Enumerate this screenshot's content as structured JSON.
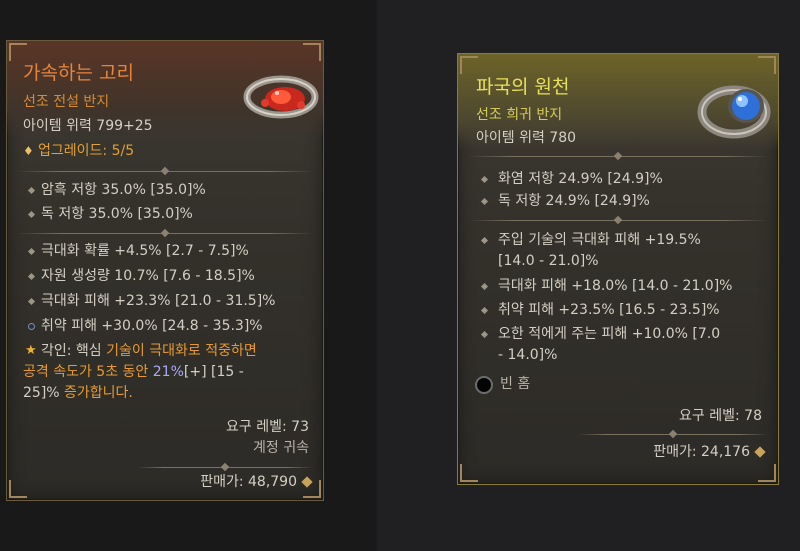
{
  "left_item": {
    "name": "가속하는 고리",
    "type": "선조 전설 반지",
    "power": "아이템 위력 799+25",
    "upgrade": "업그레이드: 5/5",
    "implicits": [
      "암흑 저항 35.0% [35.0]%",
      "독 저항 35.0% [35.0]%"
    ],
    "affixes": [
      "극대화 확률 +4.5% [2.7 - 7.5]%",
      "자원 생성량 10.7% [7.6 - 18.5]%",
      "극대화 피해 +23.3% [21.0 - 31.5]%",
      "취약 피해 +30.0% [24.8 - 35.3]%"
    ],
    "aspect": {
      "prefix": "각인: 핵심 ",
      "line1_highlight": "기술이 극대화로 적중하면",
      "line2_highlight": "공격 속도가 5초 동안 ",
      "line2_value": "21%",
      "line2_rest": "[+] [15 -",
      "line3_rest": "25]% ",
      "line3_highlight": "증가합니다."
    },
    "required_level": "요구 레벨: 73",
    "binding": "계정 귀속",
    "sell_price": "판매가: 48,790"
  },
  "right_item": {
    "name": "파국의 원천",
    "type": "선조 희귀 반지",
    "power": "아이템 위력 780",
    "implicits": [
      "화염 저항 24.9% [24.9]%",
      "독 저항 24.9% [24.9]%"
    ],
    "affixes_line1": "주입 기술의 극대화 피해 +19.5%",
    "affixes_line1b": "[14.0 - 21.0]%",
    "affix2": "극대화 피해 +18.0% [14.0 - 21.0]%",
    "affix3": "취약 피해 +23.5% [16.5 - 23.5]%",
    "affix4_a": "오한 적에게 주는 피해 +10.0% [7.0",
    "affix4_b": "- 14.0]%",
    "socket": "빈 홈",
    "required_level": "요구 레벨: 78",
    "sell_price": "판매가: 24,176"
  },
  "colors": {
    "legendary_title": "#e8843a",
    "rare_title": "#e8e05a",
    "aspect_highlight": "#e89a30",
    "aspect_value": "#a8a8f5"
  },
  "icons": [
    "diamond-icon",
    "star-icon",
    "socket-icon",
    "gold-coin-icon",
    "ring-icon"
  ]
}
